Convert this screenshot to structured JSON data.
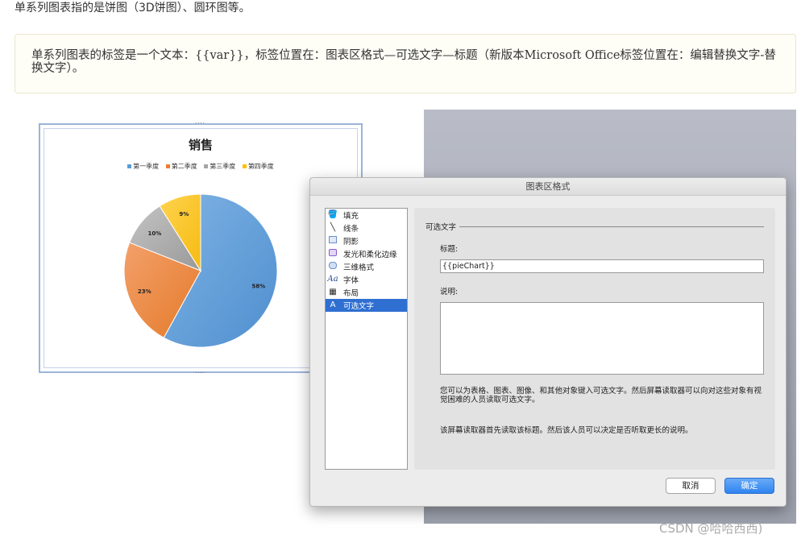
{
  "intro": "单系列图表指的是饼图（3D饼图）、圆环图等。",
  "note": "单系列图表的标签是一个文本：{{var}}，标签位置在：图表区格式—可选文字—标题（新版本Microsoft Office标签位置在：编辑替换文字-替换文字）。",
  "chart": {
    "title": "销售",
    "legend": [
      {
        "label": "第一季度",
        "color": "#5b9bd5"
      },
      {
        "label": "第二季度",
        "color": "#ed7d31"
      },
      {
        "label": "第三季度",
        "color": "#a5a5a5"
      },
      {
        "label": "第四季度",
        "color": "#ffc000"
      }
    ]
  },
  "chart_data": {
    "type": "pie",
    "title": "销售",
    "categories": [
      "第一季度",
      "第二季度",
      "第三季度",
      "第四季度"
    ],
    "values": [
      58,
      23,
      10,
      9
    ],
    "labels": [
      "58%",
      "23%",
      "10%",
      "9%"
    ],
    "colors": [
      "#5b9bd5",
      "#ed7d31",
      "#a5a5a5",
      "#ffc000"
    ],
    "legend_position": "top"
  },
  "dialog": {
    "title": "图表区格式",
    "sidebar": [
      {
        "label": "填充",
        "icon": "paint-bucket-icon"
      },
      {
        "label": "线条",
        "icon": "line-icon"
      },
      {
        "label": "阴影",
        "icon": "shadow-icon"
      },
      {
        "label": "发光和柔化边缘",
        "icon": "glow-icon"
      },
      {
        "label": "三维格式",
        "icon": "3d-format-icon"
      },
      {
        "label": "字体",
        "icon": "font-icon"
      },
      {
        "label": "布局",
        "icon": "layout-icon"
      },
      {
        "label": "可选文字",
        "icon": "alt-text-icon",
        "selected": true
      }
    ],
    "section": "可选文字",
    "title_label": "标题:",
    "title_value": "{{pieChart}}",
    "desc_label": "说明:",
    "help1": "您可以为表格、图表、图像、和其他对象键入可选文字。然后屏幕读取器可以向对这些对象有视觉困难的人员读取可选文字。",
    "help2": "该屏幕读取器首先读取该标题。然后该人员可以决定是否听取更长的说明。",
    "cancel": "取消",
    "ok": "确定"
  },
  "watermark": "CSDN @哈哈西西)"
}
